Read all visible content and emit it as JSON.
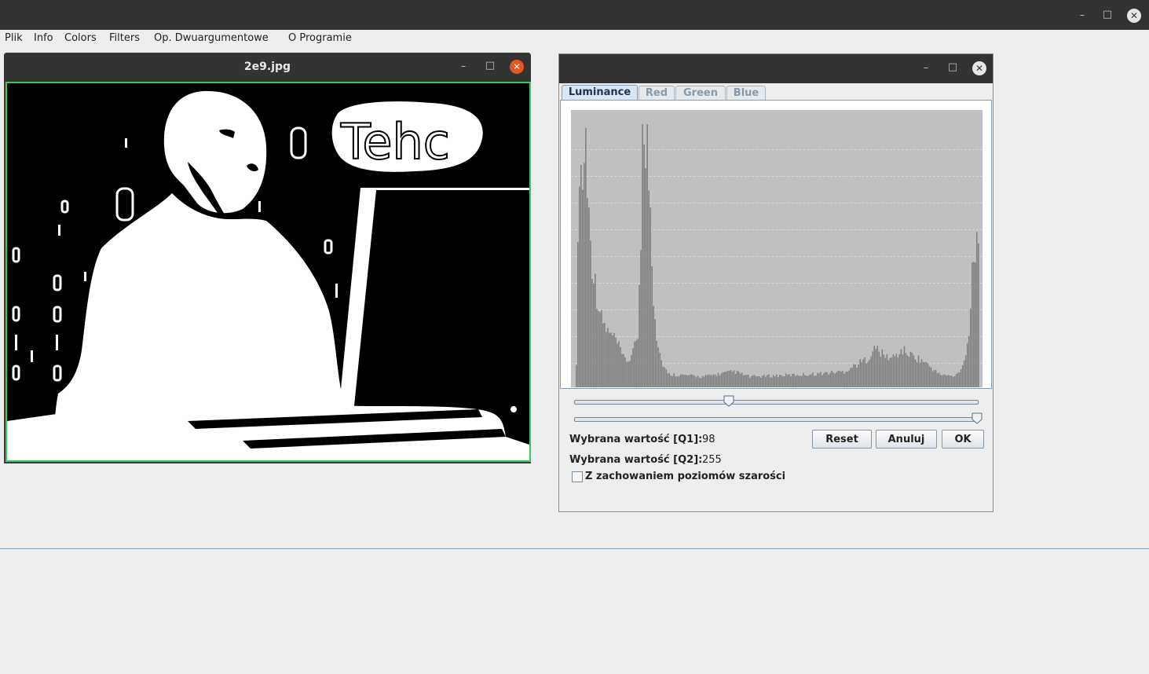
{
  "main_window": {
    "controls": {
      "minimize": "–",
      "maximize": "□",
      "close": "✕"
    }
  },
  "menubar": {
    "items": [
      "Plik",
      "Info",
      "Colors",
      "Filters",
      "Op. Dwuargumentowe",
      "O Programie"
    ]
  },
  "image_window": {
    "title": "2e9.jpg",
    "controls": {
      "minimize": "–",
      "maximize": "□",
      "close": "✕"
    },
    "overlay_text": "Tehc",
    "accent_color": "#39c95f"
  },
  "histogram_dialog": {
    "controls": {
      "minimize": "–",
      "maximize": "□",
      "close": "✕"
    },
    "tabs": [
      {
        "label": "Luminance",
        "active": true
      },
      {
        "label": "Red",
        "active": false
      },
      {
        "label": "Green",
        "active": false
      },
      {
        "label": "Blue",
        "active": false
      }
    ],
    "slider_q1": {
      "min": 0,
      "max": 255,
      "value": 98
    },
    "slider_q2": {
      "min": 0,
      "max": 255,
      "value": 255
    },
    "label_q1": "Wybrana wartość [Q1]:",
    "value_q1": "98",
    "label_q2": "Wybrana wartość [Q2]:",
    "value_q2": "255",
    "buttons": {
      "reset": "Reset",
      "cancel": "Anuluj",
      "ok": "OK"
    },
    "checkbox_label": "Z zachowaniem poziomów szarości",
    "checkbox_checked": false
  },
  "chart_data": {
    "type": "bar",
    "xlim": [
      0,
      255
    ],
    "bar_color": "#808080",
    "background": "#c0c0c0",
    "grid": true,
    "peaks": [
      {
        "x": 0,
        "y": 0.1
      },
      {
        "x": 2,
        "y": 0.88
      },
      {
        "x": 4,
        "y": 0.78
      },
      {
        "x": 6,
        "y": 0.95
      },
      {
        "x": 8,
        "y": 0.65
      },
      {
        "x": 10,
        "y": 0.48
      },
      {
        "x": 13,
        "y": 0.35
      },
      {
        "x": 16,
        "y": 0.26
      },
      {
        "x": 20,
        "y": 0.21
      },
      {
        "x": 25,
        "y": 0.18
      },
      {
        "x": 30,
        "y": 0.11
      },
      {
        "x": 33,
        "y": 0.1
      },
      {
        "x": 36,
        "y": 0.13
      },
      {
        "x": 39,
        "y": 0.2
      },
      {
        "x": 41,
        "y": 0.6
      },
      {
        "x": 42,
        "y": 1.0
      },
      {
        "x": 43,
        "y": 0.85
      },
      {
        "x": 45,
        "y": 0.92
      },
      {
        "x": 47,
        "y": 0.68
      },
      {
        "x": 49,
        "y": 0.35
      },
      {
        "x": 51,
        "y": 0.2
      },
      {
        "x": 54,
        "y": 0.1
      },
      {
        "x": 58,
        "y": 0.05
      },
      {
        "x": 70,
        "y": 0.045
      },
      {
        "x": 80,
        "y": 0.04
      },
      {
        "x": 100,
        "y": 0.06
      },
      {
        "x": 110,
        "y": 0.04
      },
      {
        "x": 130,
        "y": 0.045
      },
      {
        "x": 150,
        "y": 0.05
      },
      {
        "x": 170,
        "y": 0.06
      },
      {
        "x": 185,
        "y": 0.11
      },
      {
        "x": 190,
        "y": 0.15
      },
      {
        "x": 195,
        "y": 0.12
      },
      {
        "x": 200,
        "y": 0.11
      },
      {
        "x": 207,
        "y": 0.14
      },
      {
        "x": 213,
        "y": 0.12
      },
      {
        "x": 220,
        "y": 0.1
      },
      {
        "x": 230,
        "y": 0.05
      },
      {
        "x": 240,
        "y": 0.04
      },
      {
        "x": 245,
        "y": 0.08
      },
      {
        "x": 249,
        "y": 0.2
      },
      {
        "x": 251,
        "y": 0.45
      },
      {
        "x": 253,
        "y": 0.55
      },
      {
        "x": 255,
        "y": 0.48
      }
    ]
  }
}
